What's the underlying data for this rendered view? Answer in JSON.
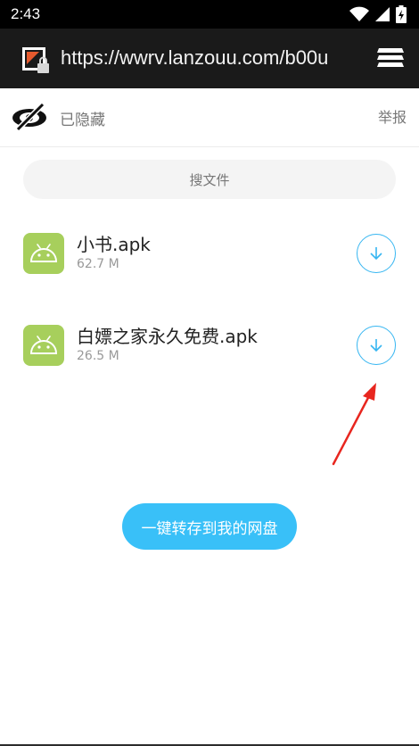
{
  "status_bar": {
    "time": "2:43"
  },
  "browser": {
    "url": "https://wwrv.lanzouu.com/b00u"
  },
  "header": {
    "hidden_label": "已隐藏",
    "report_label": "举报"
  },
  "search": {
    "label": "搜文件"
  },
  "files": [
    {
      "name": "小书.apk",
      "size": "62.7 M"
    },
    {
      "name": "白嫖之家永久免费.apk",
      "size": "26.5 M"
    }
  ],
  "actions": {
    "save_to_drive_label": "一键转存到我的网盘"
  },
  "colors": {
    "accent": "#39c0f8",
    "apk_green": "#a7cf5c",
    "arrow_red": "#e8261f"
  }
}
